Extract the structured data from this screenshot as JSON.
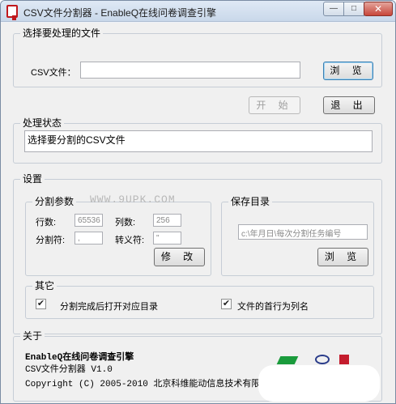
{
  "window": {
    "title": "CSV文件分割器 - EnableQ在线问卷调查引擎",
    "minimize_glyph": "—",
    "maximize_glyph": "□",
    "close_glyph": "✕"
  },
  "file_group": {
    "legend": "选择要处理的文件",
    "csv_label": "CSV文件：",
    "csv_value": "",
    "browse_label": "浏 览"
  },
  "actions": {
    "start_label": "开 始",
    "exit_label": "退 出"
  },
  "status_group": {
    "legend": "处理状态",
    "status_text": "选择要分割的CSV文件"
  },
  "settings": {
    "legend": "设置",
    "watermark": "WWW.9UPK.COM",
    "split_params": {
      "legend": "分割参数",
      "rows_label": "行数:",
      "rows_value": "65536",
      "cols_label": "列数:",
      "cols_value": "256",
      "separator_label": "分割符:",
      "separator_value": ",",
      "escape_label": "转义符:",
      "escape_value": "\"",
      "modify_label": "修 改"
    },
    "save_dir": {
      "legend": "保存目录",
      "path_value": "c:\\年月日\\每次分割任务编号",
      "browse_label": "浏 览"
    },
    "other": {
      "legend": "其它",
      "open_dir_label": "分割完成后打开对应目录",
      "open_dir_checked": true,
      "first_row_label": "文件的首行为列名",
      "first_row_checked": true,
      "check_glyph": "✔"
    }
  },
  "about": {
    "legend": "关于",
    "product": "EnableQ在线问卷调查引擎",
    "version": "CSV文件分割器  V1.0",
    "copyright": "Copyright (C) 2005-2010 北京科维能动信息技术有限公司"
  }
}
